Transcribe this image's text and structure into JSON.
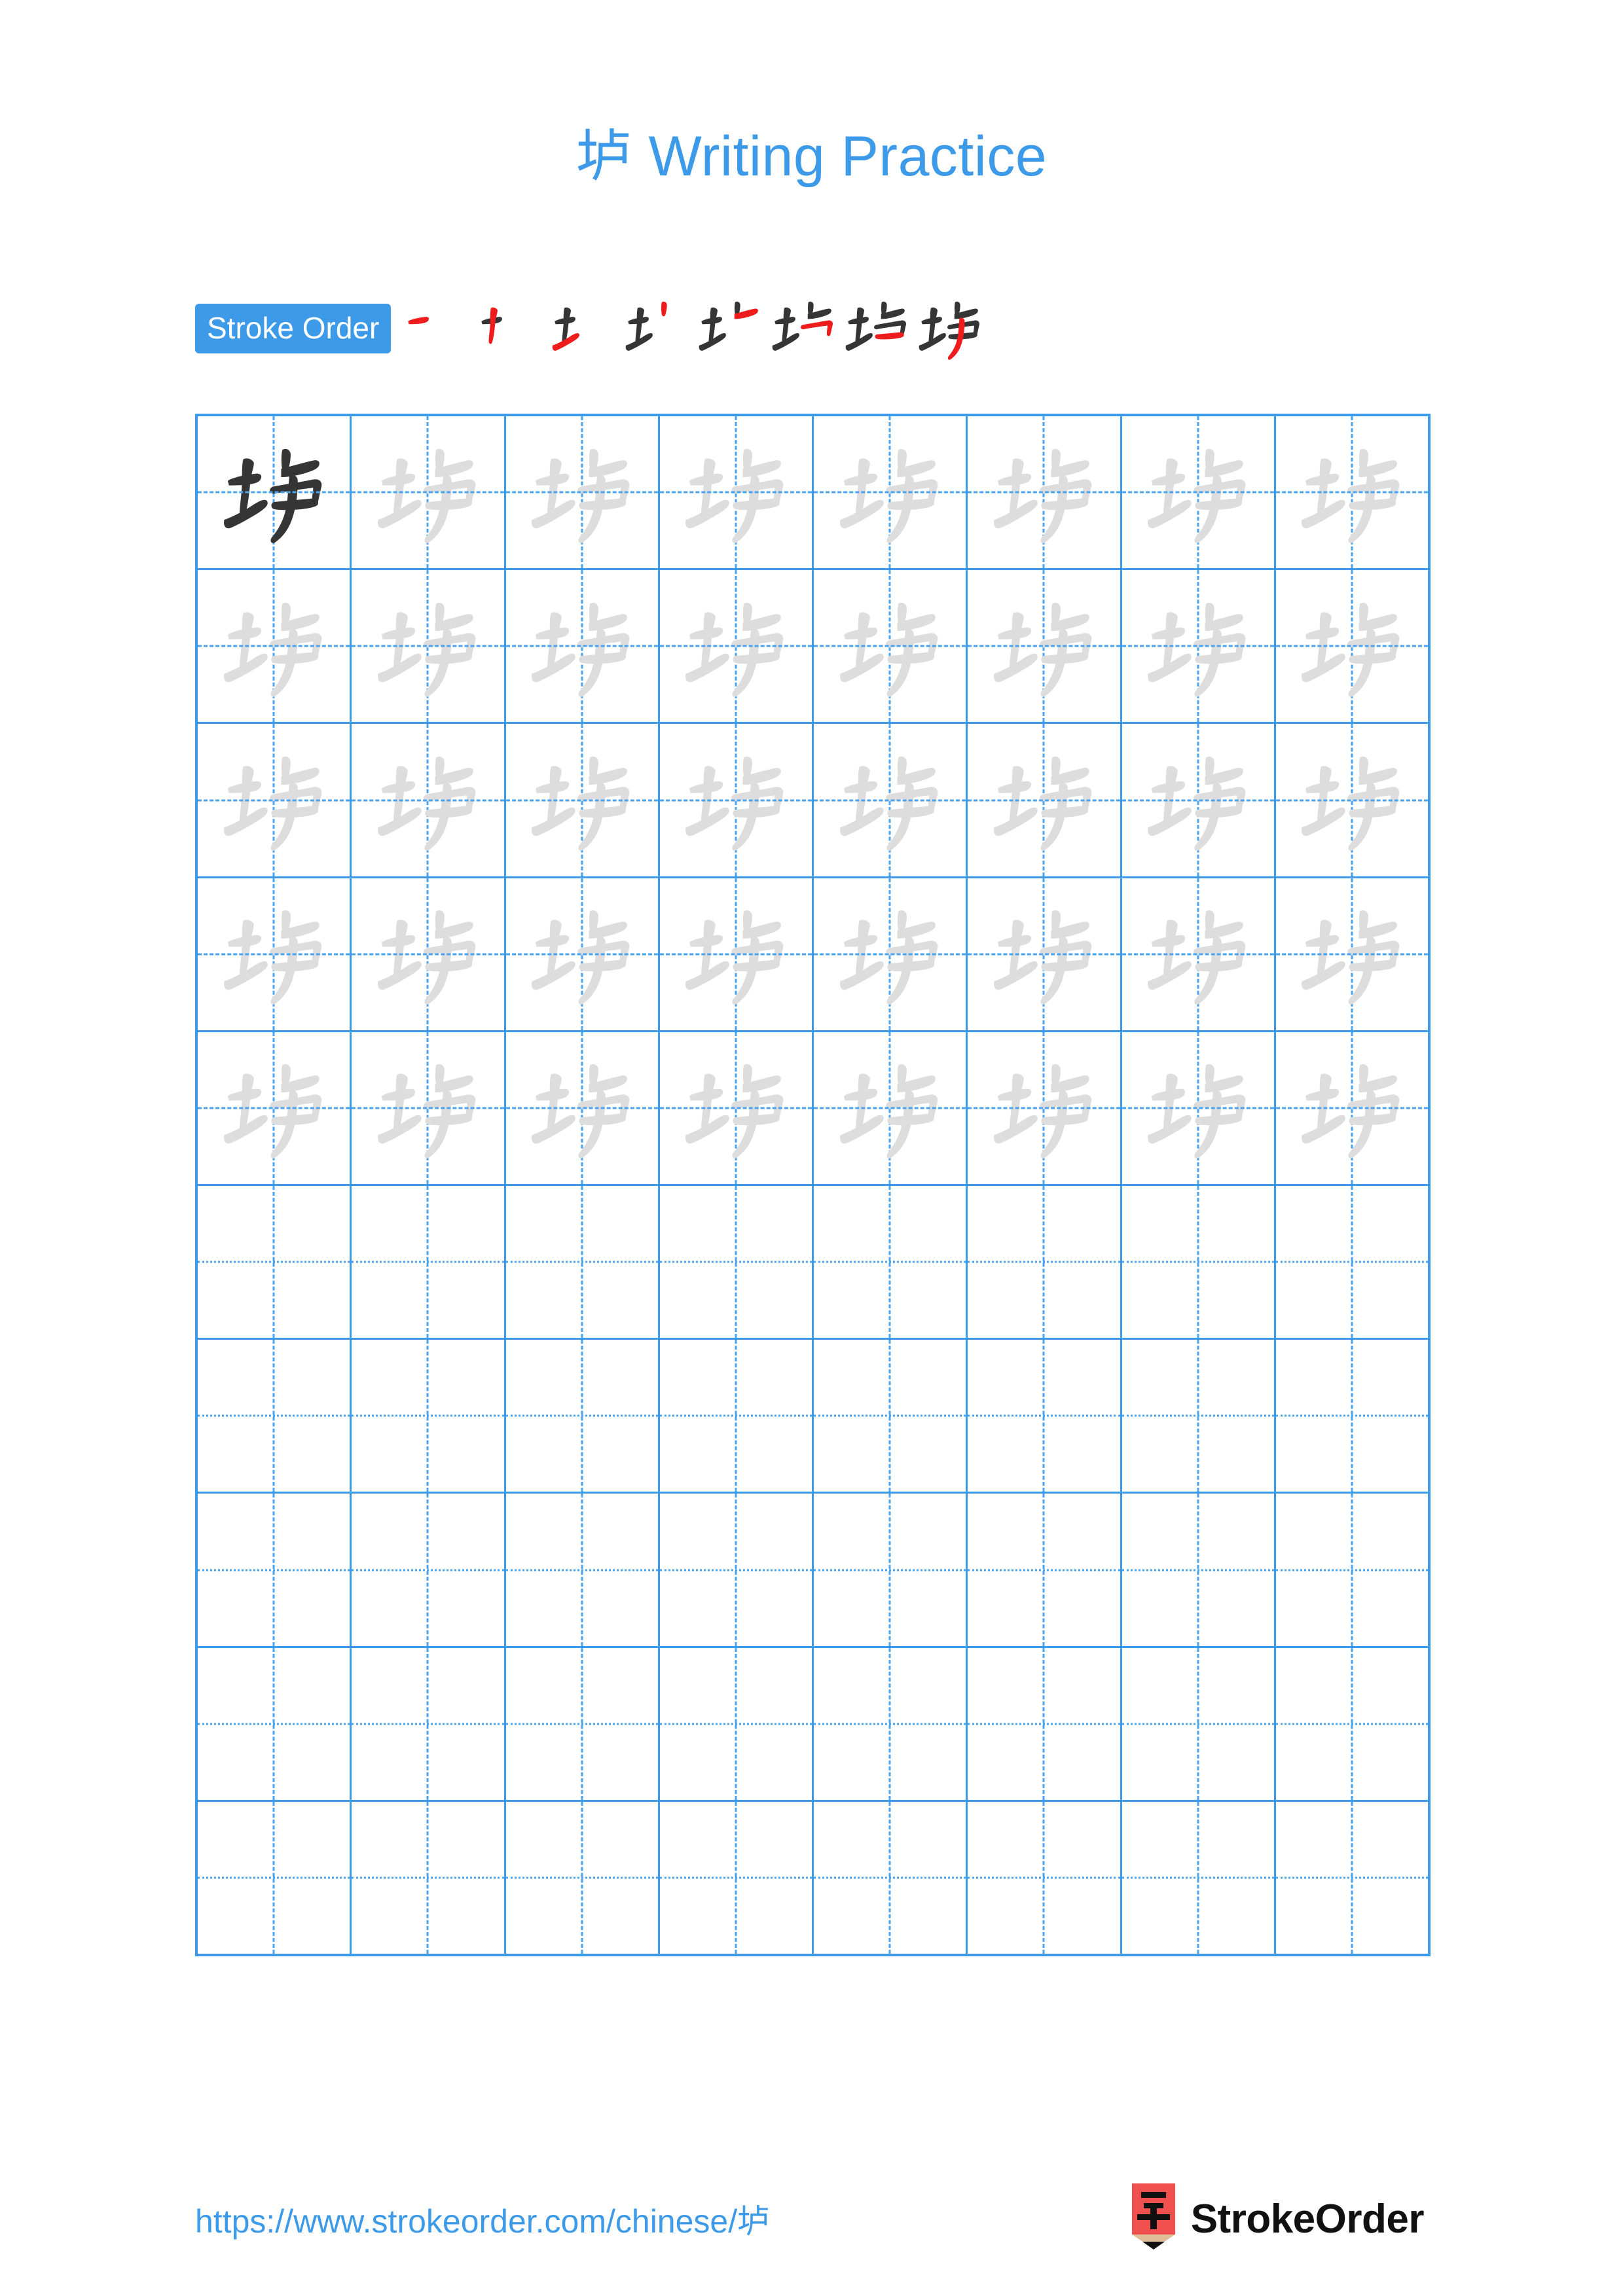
{
  "document": {
    "type": "chinese-character-writing-practice-worksheet",
    "character": "垆",
    "title_prefix": "垆",
    "title_suffix": " Writing Practice",
    "title_full": "垆 Writing Practice"
  },
  "colors": {
    "accent_blue": "#3d9ae8",
    "grid_line_blue": "#4aa3f0",
    "stroke_new_red": "#ee1c1c",
    "stroke_done_dark": "#353535",
    "trace_ghost_gray": "#dddddd",
    "logo_red": "#f0514f",
    "logo_wood": "#e0bd97",
    "brand_black": "#111111",
    "page_background": "#ffffff"
  },
  "stroke_order": {
    "badge_label": "Stroke Order",
    "total_strokes": 8,
    "steps": [
      {
        "index": 1,
        "new_stroke": "heng (horizontal)",
        "strokes_shown": 1
      },
      {
        "index": 2,
        "new_stroke": "shu (vertical)",
        "strokes_shown": 2
      },
      {
        "index": 3,
        "new_stroke": "ti (rising)",
        "strokes_shown": 3
      },
      {
        "index": 4,
        "new_stroke": "shu (vertical)",
        "strokes_shown": 4
      },
      {
        "index": 5,
        "new_stroke": "heng (horizontal)",
        "strokes_shown": 5
      },
      {
        "index": 6,
        "new_stroke": "heng-zhe (horizontal turn)",
        "strokes_shown": 6
      },
      {
        "index": 7,
        "new_stroke": "heng (horizontal)",
        "strokes_shown": 7
      },
      {
        "index": 8,
        "new_stroke": "pie (left-falling)",
        "strokes_shown": 8
      }
    ]
  },
  "practice_grid": {
    "columns": 8,
    "rows": 10,
    "filled_rows": 5,
    "empty_rows": 5,
    "cell_style": "tian-zi-ge with dashed center guides",
    "rows_data": [
      {
        "row": 1,
        "cells": [
          "solid",
          "ghost",
          "ghost",
          "ghost",
          "ghost",
          "ghost",
          "ghost",
          "ghost"
        ]
      },
      {
        "row": 2,
        "cells": [
          "ghost",
          "ghost",
          "ghost",
          "ghost",
          "ghost",
          "ghost",
          "ghost",
          "ghost"
        ]
      },
      {
        "row": 3,
        "cells": [
          "ghost",
          "ghost",
          "ghost",
          "ghost",
          "ghost",
          "ghost",
          "ghost",
          "ghost"
        ]
      },
      {
        "row": 4,
        "cells": [
          "ghost",
          "ghost",
          "ghost",
          "ghost",
          "ghost",
          "ghost",
          "ghost",
          "ghost"
        ]
      },
      {
        "row": 5,
        "cells": [
          "ghost",
          "ghost",
          "ghost",
          "ghost",
          "ghost",
          "ghost",
          "ghost",
          "ghost"
        ]
      },
      {
        "row": 6,
        "cells": [
          "empty",
          "empty",
          "empty",
          "empty",
          "empty",
          "empty",
          "empty",
          "empty"
        ]
      },
      {
        "row": 7,
        "cells": [
          "empty",
          "empty",
          "empty",
          "empty",
          "empty",
          "empty",
          "empty",
          "empty"
        ]
      },
      {
        "row": 8,
        "cells": [
          "empty",
          "empty",
          "empty",
          "empty",
          "empty",
          "empty",
          "empty",
          "empty"
        ]
      },
      {
        "row": 9,
        "cells": [
          "empty",
          "empty",
          "empty",
          "empty",
          "empty",
          "empty",
          "empty",
          "empty"
        ]
      },
      {
        "row": 10,
        "cells": [
          "empty",
          "empty",
          "empty",
          "empty",
          "empty",
          "empty",
          "empty",
          "empty"
        ]
      }
    ]
  },
  "footer": {
    "url": "https://www.strokeorder.com/chinese/垆",
    "brand_name": "StrokeOrder",
    "logo_character": "字",
    "logo_icon": "pencil-icon"
  }
}
